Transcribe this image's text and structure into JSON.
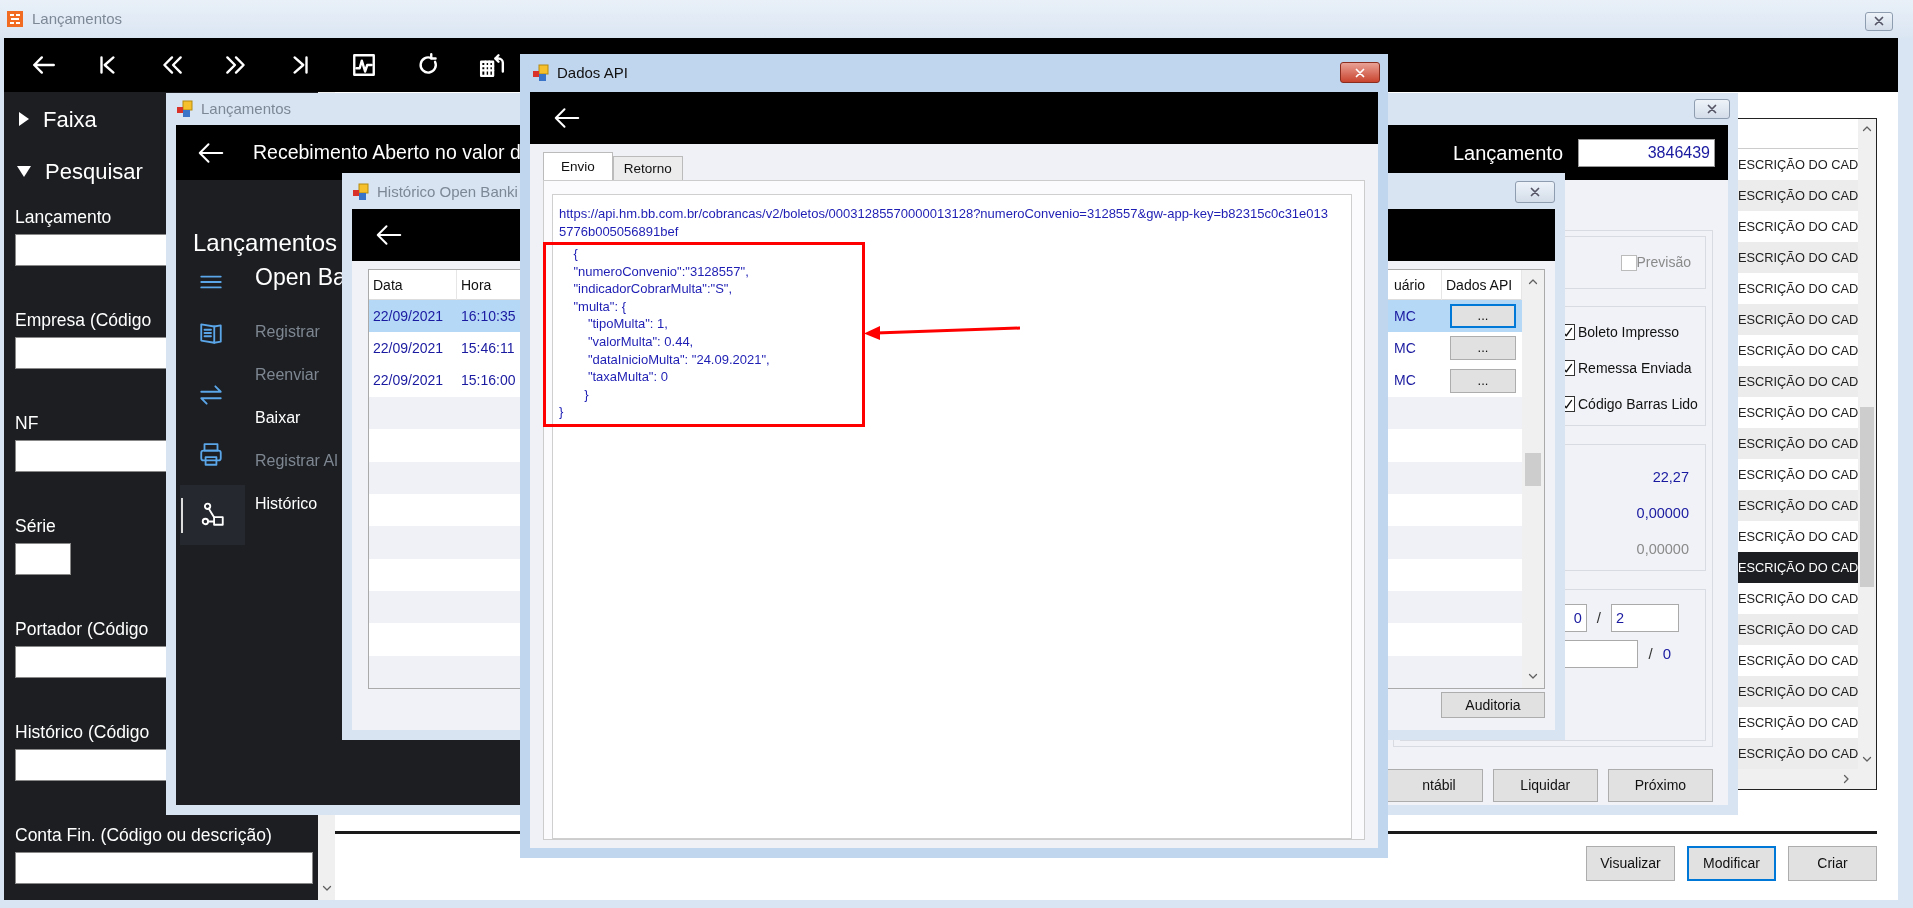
{
  "main_window": {
    "title": "Lançamentos"
  },
  "sidebar": {
    "sections": [
      {
        "label": "Faixa",
        "expanded": false
      },
      {
        "label": "Pesquisar",
        "expanded": true
      }
    ],
    "fields": [
      {
        "label": "Lançamento",
        "kind": "long"
      },
      {
        "label": "Empresa (Código",
        "kind": "long"
      },
      {
        "label": "NF",
        "kind": "long"
      },
      {
        "label": "Série",
        "kind": "short"
      },
      {
        "label": "Portador (Código",
        "kind": "long"
      },
      {
        "label": "Histórico (Código",
        "kind": "long"
      },
      {
        "label": "Conta Fin. (Código ou descrição)",
        "kind": "long"
      }
    ]
  },
  "list": {
    "rows": [
      {
        "text": "ESCRIÇÃO DO CAD",
        "selected": false
      },
      {
        "text": "ESCRIÇÃO DO CAD",
        "selected": false
      },
      {
        "text": "ESCRIÇÃO DO CAD",
        "selected": false
      },
      {
        "text": "ESCRIÇÃO DO CAD",
        "selected": false
      },
      {
        "text": "ESCRIÇÃO DO CAD",
        "selected": false
      },
      {
        "text": "ESCRIÇÃO DO CAD",
        "selected": false
      },
      {
        "text": "ESCRIÇÃO DO CAD",
        "selected": false
      },
      {
        "text": "ESCRIÇÃO DO CAD",
        "selected": false
      },
      {
        "text": "ESCRIÇÃO DO CAD",
        "selected": false
      },
      {
        "text": "ESCRIÇÃO DO CAD",
        "selected": false
      },
      {
        "text": "ESCRIÇÃO DO CAD",
        "selected": false
      },
      {
        "text": "ESCRIÇÃO DO CAD",
        "selected": false
      },
      {
        "text": "ESCRIÇÃO DO CAD",
        "selected": false
      },
      {
        "text": "ESCRIÇÃO DO CAD",
        "selected": true
      },
      {
        "text": "ESCRIÇÃO DO CAD",
        "selected": false
      },
      {
        "text": "ESCRIÇÃO DO CAD",
        "selected": false
      },
      {
        "text": "ESCRIÇÃO DO CAD",
        "selected": false
      },
      {
        "text": "ESCRIÇÃO DO CAD",
        "selected": false
      },
      {
        "text": "ESCRIÇÃO DO CAD",
        "selected": false
      },
      {
        "text": "ESCRIÇÃO DO CAD",
        "selected": false
      }
    ]
  },
  "buttons": [
    {
      "label": "Visualizar",
      "focused": false
    },
    {
      "label": "Modificar",
      "focused": true
    },
    {
      "label": "Criar",
      "focused": false
    }
  ],
  "lancamentos_window": {
    "title": "Lançamentos",
    "header": "Recebimento Aberto no valor d",
    "lancamento_label": "Lançamento",
    "lancamento_value": "3846439",
    "nav_title": "Lançamentos",
    "menu": [
      {
        "label": "Open Ba",
        "kind": "heading",
        "disabled": false,
        "selected": false
      },
      {
        "label": "Registrar",
        "kind": "item",
        "disabled": true,
        "selected": false
      },
      {
        "label": "Reenviar",
        "kind": "item",
        "disabled": true,
        "selected": false
      },
      {
        "label": "Baixar",
        "kind": "item",
        "disabled": false,
        "selected": false
      },
      {
        "label": "Registrar Al",
        "kind": "item",
        "disabled": true,
        "selected": false
      },
      {
        "label": "Histórico",
        "kind": "item",
        "disabled": false,
        "selected": true
      }
    ],
    "previsao": {
      "label": "Previsão",
      "checked": false,
      "disabled": true
    },
    "flags": [
      {
        "label": "Boleto Impresso",
        "checked": true
      },
      {
        "label": "Remessa Enviada",
        "checked": true
      },
      {
        "label": "Código Barras Lido",
        "checked": true
      }
    ],
    "values": [
      {
        "text": "22,27",
        "disabled": false
      },
      {
        "text": "0,00000",
        "disabled": false
      },
      {
        "text": "0,00000",
        "disabled": true
      }
    ],
    "counts": [
      {
        "kind": "fields",
        "value": "0",
        "separator": "/",
        "total": "2"
      },
      {
        "kind": "text",
        "separator": "/",
        "total": "0"
      }
    ],
    "actions": [
      {
        "label": "ntábil"
      },
      {
        "label": "Liquidar"
      },
      {
        "label": "Próximo"
      }
    ]
  },
  "historico_window": {
    "title": "Histórico Open Banki",
    "columns": [
      "Data",
      "Hora",
      "uário",
      "Dados API"
    ],
    "rows": [
      {
        "date": "22/09/2021",
        "time": "16:10:35",
        "user": "MC",
        "action": "...",
        "selected": true
      },
      {
        "date": "22/09/2021",
        "time": "15:46:11",
        "user": "MC",
        "action": "...",
        "selected": false
      },
      {
        "date": "22/09/2021",
        "time": "15:16:00",
        "user": "MC",
        "action": "...",
        "selected": false
      }
    ],
    "audit_button": "Auditoria"
  },
  "dados_api_window": {
    "title": "Dados API",
    "tabs": [
      {
        "label": "Envio",
        "selected": true
      },
      {
        "label": "Retorno",
        "selected": false
      }
    ],
    "url": "https://api.hm.bb.com.br/cobrancas/v2/boletos/00031285570000013128?numeroConvenio=3128557&gw-app-key=b82315c0c31e0135776b005056891bef",
    "body": "    {\n    \"numeroConvenio\":\"3128557\",\n    \"indicadorCobrarMulta\":\"S\",\n    \"multa\": {\n        \"tipoMulta\": 1,\n        \"valorMulta\": 0.44,\n        \"dataInicioMulta\": \"24.09.2021\",\n        \"taxaMulta\": 0\n       }\n}"
  }
}
